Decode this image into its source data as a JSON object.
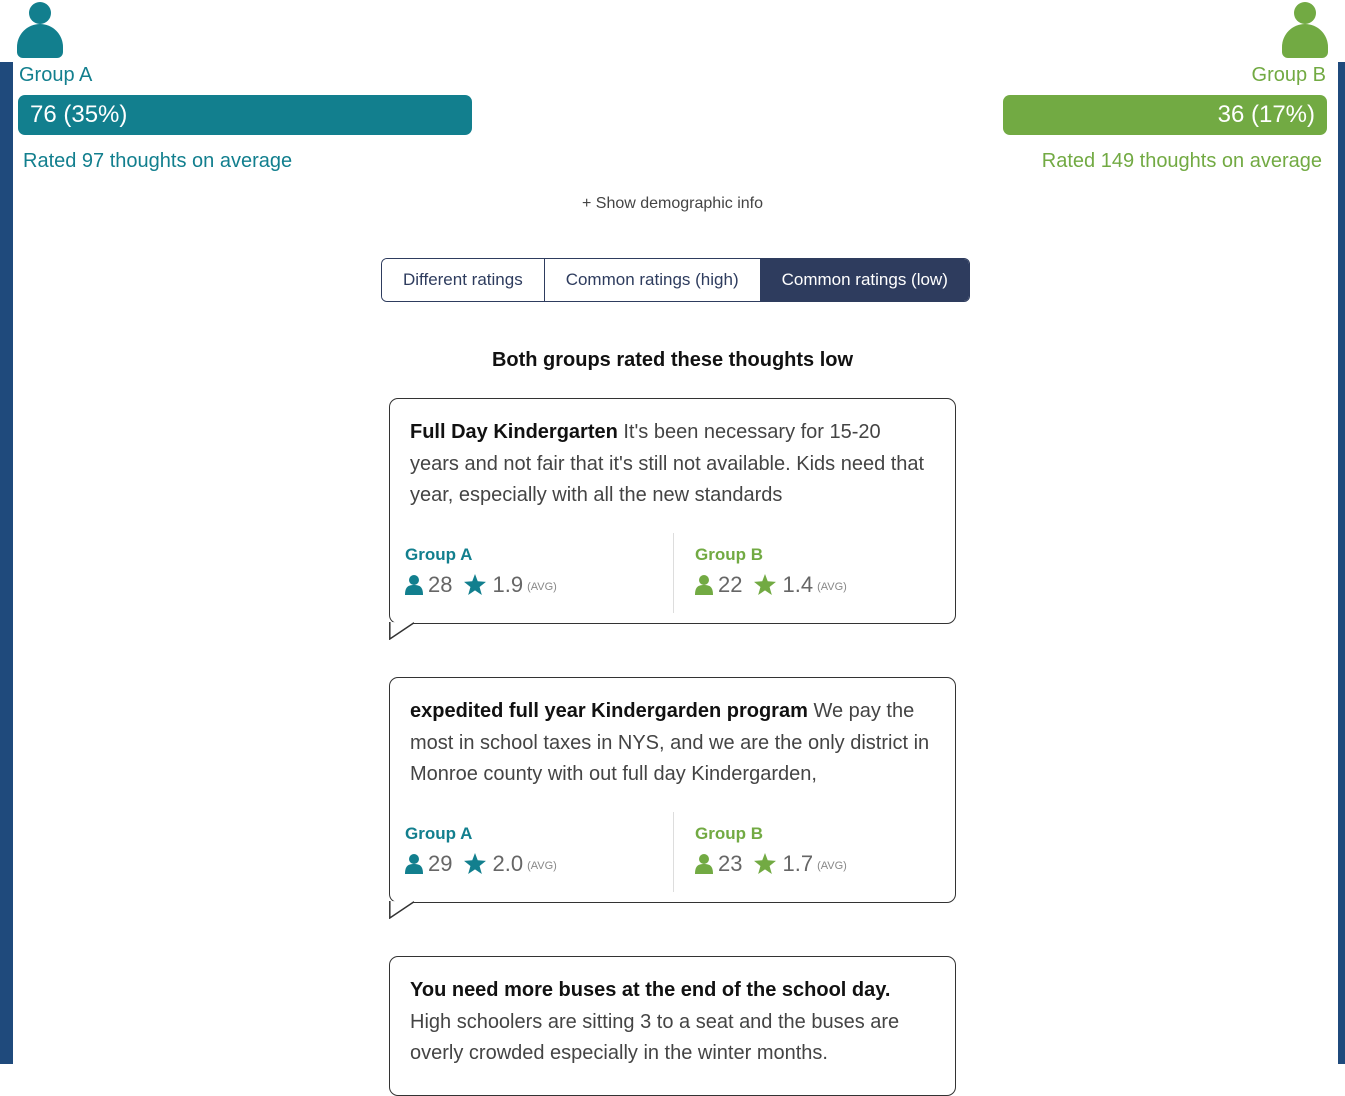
{
  "groups": {
    "a": {
      "name": "Group A",
      "count_label": "76 (35%)",
      "avg_text": "Rated 97 thoughts on average",
      "color": "#127f8e",
      "share": 0.35
    },
    "b": {
      "name": "Group B",
      "count_label": "36 (17%)",
      "avg_text": "Rated 149 thoughts on average",
      "color": "#72aa43",
      "share": 0.17
    }
  },
  "demographic_toggle": "+ Show demographic info",
  "tabs": [
    {
      "label": "Different ratings",
      "active": false
    },
    {
      "label": "Common ratings (high)",
      "active": false
    },
    {
      "label": "Common ratings (low)",
      "active": true
    }
  ],
  "section_title": "Both groups rated these thoughts low",
  "cards": [
    {
      "title": "Full Day Kindergarten",
      "body": "It's been necessary for 15-20 years and not fair that it's still not available. Kids need that year, especially with all the new standards",
      "group_a": {
        "label": "Group A",
        "count": "28",
        "rating": "1.9",
        "avg": "(AVG)"
      },
      "group_b": {
        "label": "Group B",
        "count": "22",
        "rating": "1.4",
        "avg": "(AVG)"
      }
    },
    {
      "title": "expedited full year Kindergarden program",
      "body": "We pay the most in school taxes in NYS, and we are the only district in Monroe county with out full day Kindergarden,",
      "group_a": {
        "label": "Group A",
        "count": "29",
        "rating": "2.0",
        "avg": "(AVG)"
      },
      "group_b": {
        "label": "Group B",
        "count": "23",
        "rating": "1.7",
        "avg": "(AVG)"
      }
    },
    {
      "title": "You need more buses at the end of the school day.",
      "body": "High schoolers are sitting 3 to a seat and the buses are overly crowded especially in the winter months."
    }
  ],
  "icons": {
    "person": "person-icon",
    "star": "star-icon"
  }
}
